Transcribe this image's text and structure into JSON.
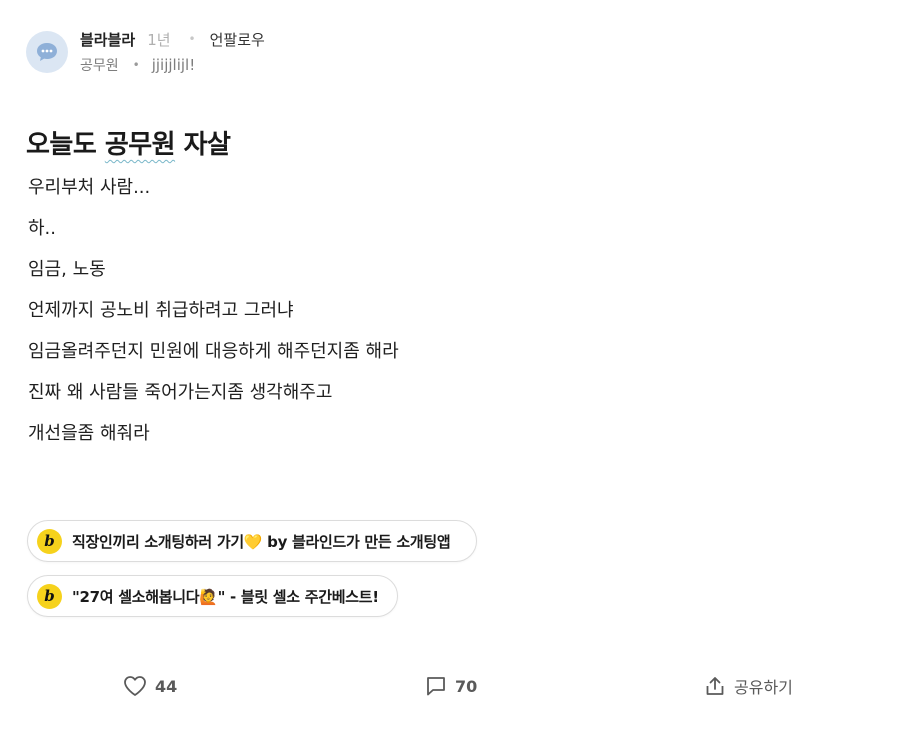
{
  "post": {
    "author": "블라블라",
    "time": "1년",
    "unfollow_label": "언팔로우",
    "company": "공무원",
    "nickname": "jjijjlijl!"
  },
  "title": {
    "part1": "오늘도 ",
    "part2": "공무원",
    "part3": " 자살"
  },
  "body_lines": [
    "우리부처 사람...",
    "하..",
    "임금, 노동",
    "언제까지 공노비 취급하려고 그러냐",
    "임금올려주던지 민원에 대응하게 해주던지좀 해라",
    "진짜 왜 사람들 죽어가는지좀 생각해주고",
    "개선을좀 해줘라"
  ],
  "promos": [
    {
      "badge": "b",
      "text": "직장인끼리 소개팅하러 가기💛 by 블라인드가 만든 소개팅앱"
    },
    {
      "badge": "b",
      "text": "\"27여 셀소해봅니다🙋\" - 블릿 셀소 주간베스트!"
    }
  ],
  "actions": {
    "likes": "44",
    "comments": "70",
    "share_label": "공유하기"
  },
  "colors": {
    "badge_yellow": "#f6d21c",
    "avatar_bg": "#dbe6f3",
    "avatar_fg": "#8fb0d8"
  },
  "icons": [
    "chat-bubble-icon",
    "heart-icon",
    "comment-icon",
    "share-icon"
  ]
}
